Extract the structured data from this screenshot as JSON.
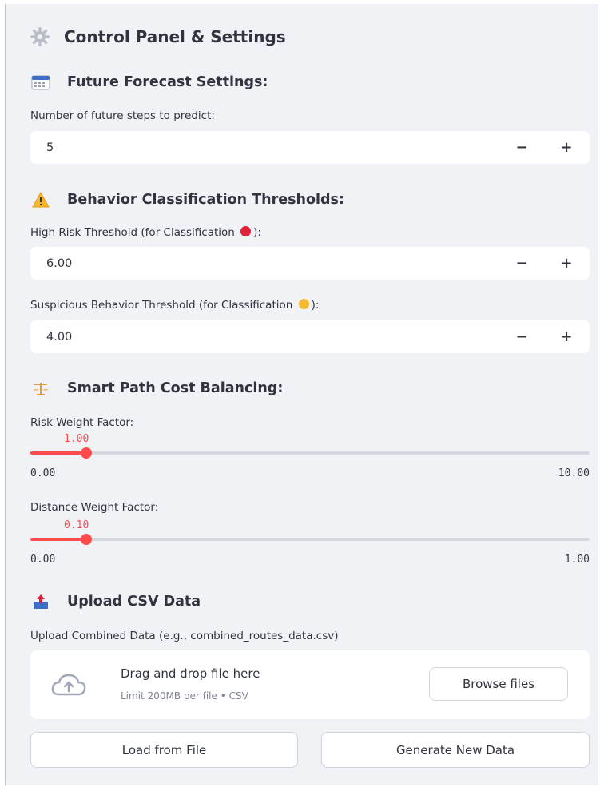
{
  "panel": {
    "title": "Control Panel & Settings"
  },
  "forecast": {
    "heading": "Future Forecast Settings:",
    "steps_label": "Number of future steps to predict:",
    "steps_value": "5"
  },
  "behavior": {
    "heading": "Behavior Classification Thresholds:",
    "high_risk_label_before": "High Risk Threshold (for Classification ",
    "high_risk_label_after": "):",
    "high_risk_value": "6.00",
    "suspicious_label_before": "Suspicious Behavior Threshold (for Classification ",
    "suspicious_label_after": "):",
    "suspicious_value": "4.00"
  },
  "path_cost": {
    "heading": "Smart Path Cost Balancing:",
    "risk_weight": {
      "label": "Risk Weight Factor:",
      "value_text": "1.00",
      "min_text": "0.00",
      "max_text": "10.00",
      "fraction": 0.1
    },
    "distance_weight": {
      "label": "Distance Weight Factor:",
      "value_text": "0.10",
      "min_text": "0.00",
      "max_text": "1.00",
      "fraction": 0.1
    }
  },
  "upload": {
    "heading": "Upload CSV Data",
    "label": "Upload Combined Data (e.g., combined_routes_data.csv)",
    "drop_title": "Drag and drop file here",
    "drop_sub": "Limit 200MB per file • CSV",
    "browse_label": "Browse files"
  },
  "actions": {
    "load_label": "Load from File",
    "generate_label": "Generate New Data"
  },
  "colors": {
    "accent": "#ff4b4b",
    "high_risk_dot": "#e0213a",
    "suspicious_dot": "#f5b82e",
    "background": "#f0f2f6"
  },
  "icons": {
    "title": "gear-icon",
    "forecast": "calendar-icon",
    "behavior": "warning-icon",
    "path_cost": "scale-icon",
    "upload": "inbox-tray-icon",
    "dropzone": "cloud-upload-icon",
    "stepper_minus": "minus-icon",
    "stepper_plus": "plus-icon"
  }
}
